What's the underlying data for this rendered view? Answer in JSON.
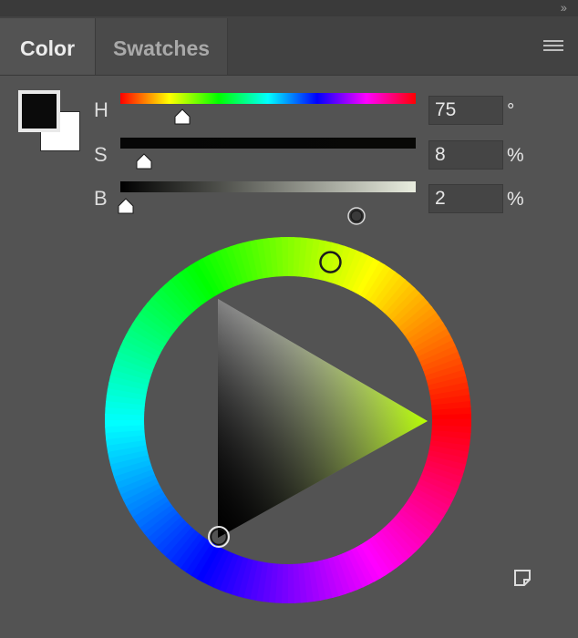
{
  "panel": {
    "collapse_glyph": "››",
    "tabs": [
      {
        "label": "Color",
        "active": true
      },
      {
        "label": "Swatches",
        "active": false
      }
    ],
    "menu_icon": "hamburger-menu-icon"
  },
  "swatches": {
    "foreground_color": "#0b0b0b",
    "background_color": "#ffffff"
  },
  "sliders": {
    "h": {
      "label": "H",
      "value": "75",
      "unit": "°"
    },
    "s": {
      "label": "S",
      "value": "8",
      "unit": "%"
    },
    "b": {
      "label": "B",
      "value": "2",
      "unit": "%"
    }
  },
  "wheel": {
    "hue_degrees": 75,
    "saturation_percent": 8,
    "brightness_percent": 2
  },
  "footer": {
    "icon": "new-swatch-icon"
  }
}
